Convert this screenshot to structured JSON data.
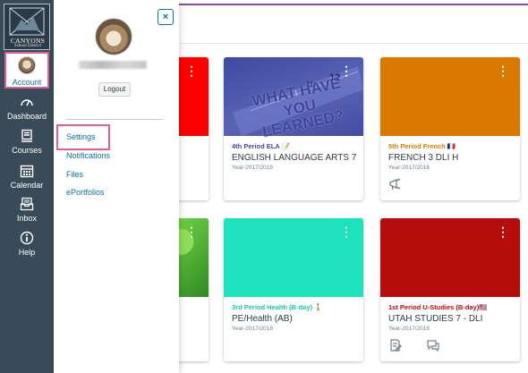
{
  "global_nav": {
    "logo": {
      "line1": "CANYONS",
      "line2": "School District"
    },
    "items": [
      {
        "label": "Account",
        "icon": "user-avatar"
      },
      {
        "label": "Dashboard",
        "icon": "dashboard-icon"
      },
      {
        "label": "Courses",
        "icon": "courses-icon"
      },
      {
        "label": "Calendar",
        "icon": "calendar-icon"
      },
      {
        "label": "Inbox",
        "icon": "inbox-icon"
      },
      {
        "label": "Help",
        "icon": "help-icon"
      }
    ]
  },
  "account_tray": {
    "close_label": "×",
    "logout_label": "Logout",
    "links": [
      {
        "label": "Settings"
      },
      {
        "label": "Notifications"
      },
      {
        "label": "Files"
      },
      {
        "label": "ePortfolios"
      }
    ]
  },
  "cards": [
    {
      "nickname": "4th Period ELA 📝",
      "title": "ENGLISH LANGUAGE ARTS 7",
      "term": "Year-2017/2018",
      "color": "#5058a6",
      "hero_text": "WHAT HAVE YOU LEARNED?"
    },
    {
      "nickname": "5th Period French 🇫🇷",
      "title": "FRENCH 3 DLI H",
      "term": "Year-2017/2018",
      "color": "#d97900"
    },
    {
      "nickname": "3rd Period Health (B-day) 🚶",
      "title": "PE/Health (AB)",
      "term": "Year-2017/2018",
      "color": "#1de2bd"
    },
    {
      "nickname": "1st Period U-Studies (B-day)🇺🇸",
      "title": "UTAH STUDIES 7 - DLI",
      "term": "Year-2017/2018",
      "color": "#b50c0c"
    }
  ],
  "partial_cards": [
    {
      "color": "#ff0000"
    },
    {
      "color": "#4cae2f"
    }
  ],
  "kebab": "⋮"
}
